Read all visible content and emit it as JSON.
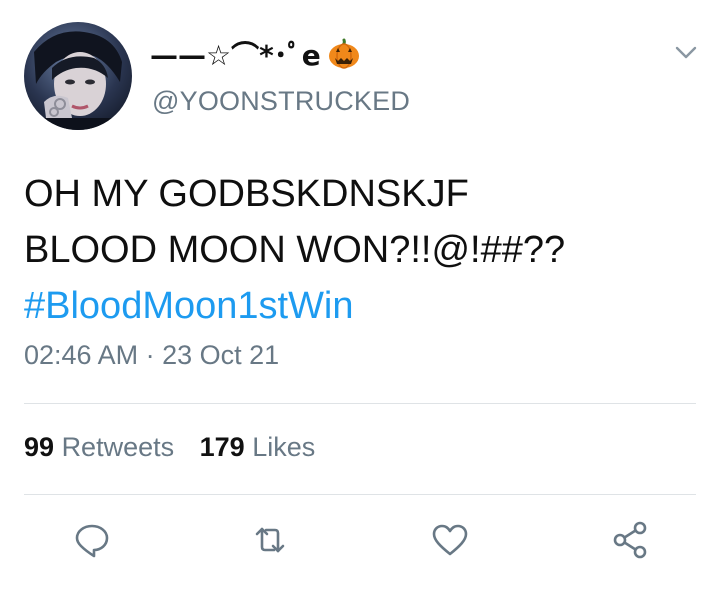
{
  "user": {
    "display_name": "——☆⌒*･ﾟe",
    "handle": "@YOONSTRUCKED",
    "avatar_icon": "avatar-photo",
    "emoji_icon": "pumpkin-icon"
  },
  "tweet": {
    "line1": "OH MY GODBSKDNSKJF",
    "line2": "BLOOD MOON WON?!!@!##??",
    "hashtag": "#BloodMoon1stWin",
    "timestamp": "02:46 AM · 23 Oct 21"
  },
  "stats": {
    "retweets_count": "99",
    "retweets_label": "Retweets",
    "likes_count": "179",
    "likes_label": "Likes"
  },
  "actions": [
    "reply-icon",
    "retweet-icon",
    "like-icon",
    "share-icon"
  ],
  "colors": {
    "hashtag": "#1d9bf0",
    "secondary_text": "#687885",
    "icon": "#687885",
    "divider": "#dfe3e6"
  }
}
